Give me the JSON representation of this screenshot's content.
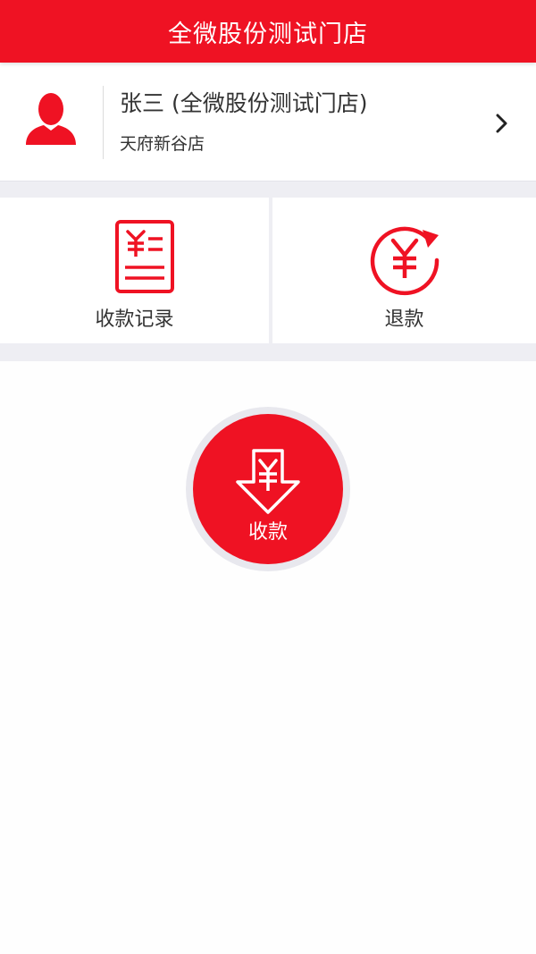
{
  "header": {
    "title": "全微股份测试门店"
  },
  "user": {
    "name": "张三 (全微股份测试门店)",
    "store": "天府新谷店",
    "avatar_icon": "user-avatar-icon",
    "arrow_icon": "chevron-right-icon"
  },
  "actions": [
    {
      "label": "收款记录",
      "icon": "receipt-yuan-icon"
    },
    {
      "label": "退款",
      "icon": "refund-yuan-icon"
    }
  ],
  "pay": {
    "label": "收款",
    "icon": "yuan-down-arrow-icon"
  },
  "colors": {
    "brand_red": "#ef1223",
    "background": "#fefefe",
    "band_gray": "#eeeef3",
    "text_dark": "#333333"
  }
}
